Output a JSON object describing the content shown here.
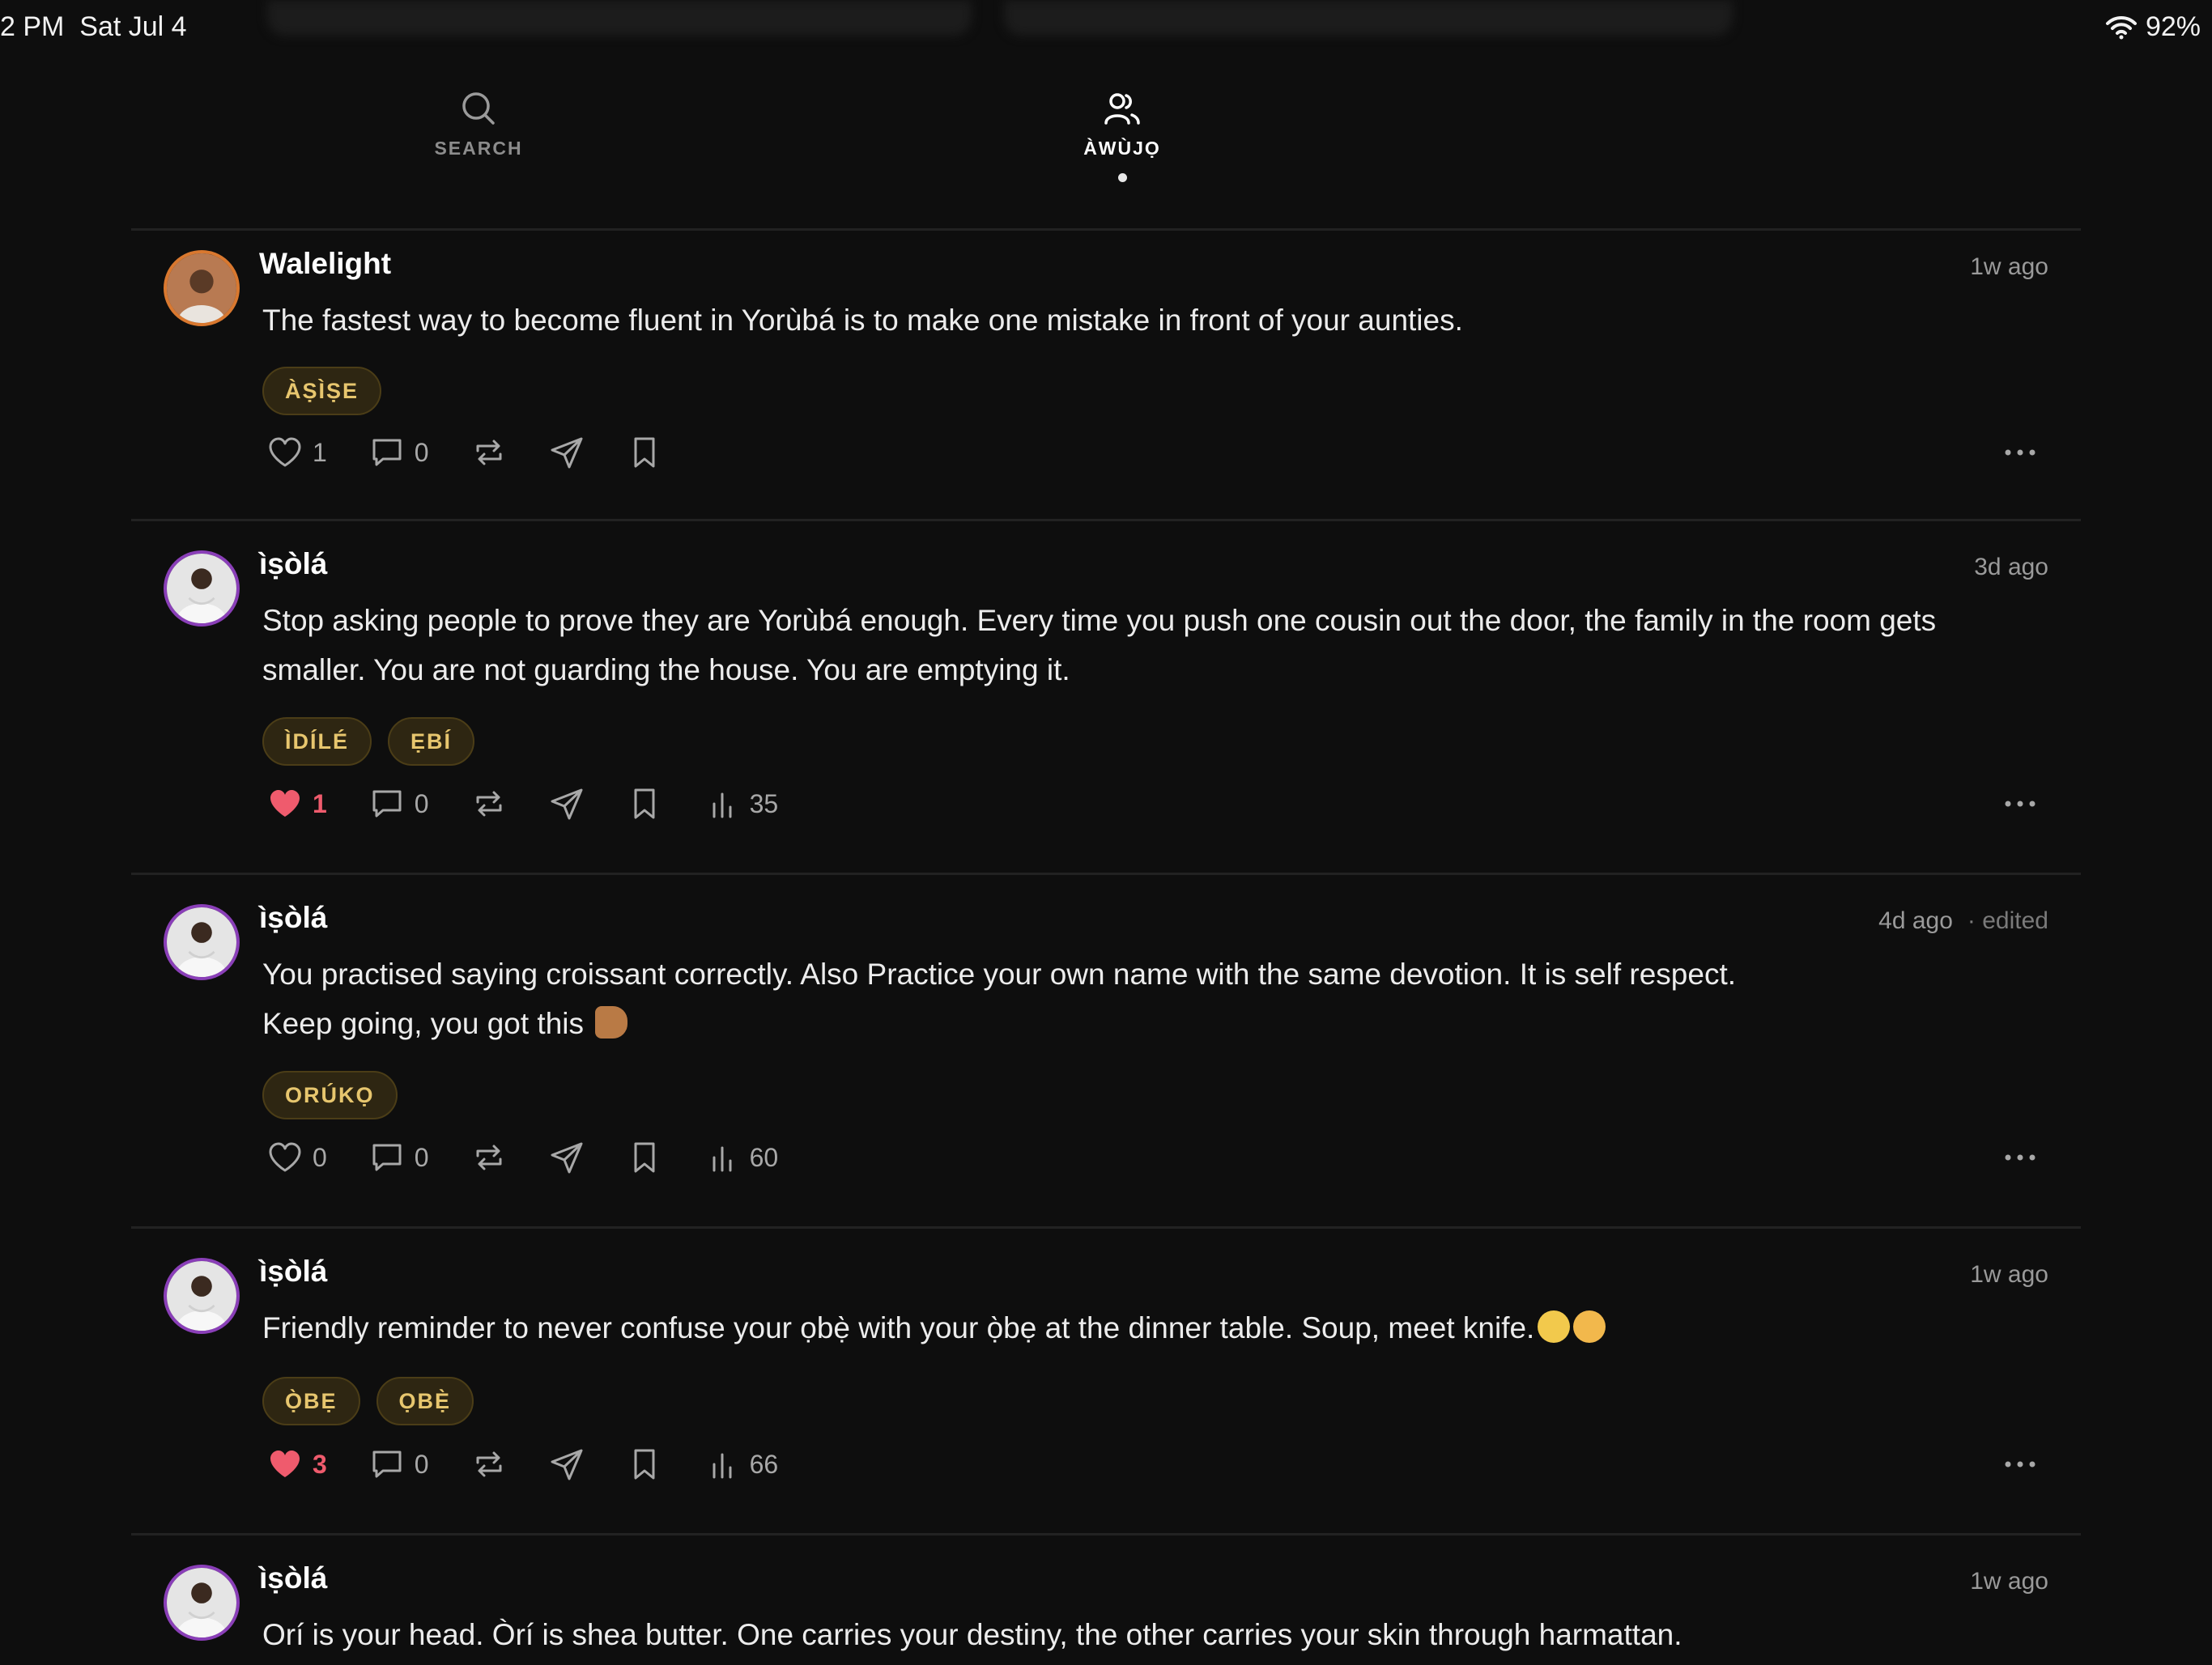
{
  "status_bar": {
    "time": "2 PM",
    "date": "Sat Jul 4",
    "battery": "92%"
  },
  "tabs": [
    {
      "label": "SEARCH",
      "icon": "search-icon",
      "active": false
    },
    {
      "label": "ÀWÙJỌ",
      "icon": "users-icon",
      "active": true
    }
  ],
  "posts": [
    {
      "username": "Walelight",
      "time": "1w ago",
      "content": "The fastest way to become fluent in Yorùbá is to make one mistake in front of your aunties.",
      "tags": [
        "ÀṢÌṢE"
      ],
      "likes": "1",
      "liked": false,
      "comments": "0"
    },
    {
      "username": "ìṣòlá",
      "time": "3d ago",
      "content": "Stop asking people to prove they are Yorùbá enough. Every time you push one cousin out the door, the family in the room gets smaller. You are not guarding the house. You are emptying it.",
      "tags": [
        "ÌDÍLÉ",
        "ẸBÍ"
      ],
      "likes": "1",
      "liked": true,
      "comments": "0",
      "views": "35"
    },
    {
      "username": "ìṣòlá",
      "time": "4d ago",
      "edited": "· edited",
      "content_lines": [
        "You practised saying croissant correctly. Also Practice your own name with the same devotion. It is self respect.",
        "Keep going, you got this"
      ],
      "emoji": "flexed-biceps-emoji",
      "tags": [
        "ORÚKỌ"
      ],
      "likes": "0",
      "liked": false,
      "comments": "0",
      "views": "60"
    },
    {
      "username": "ìṣòlá",
      "time": "1w ago",
      "content": "Friendly reminder to never confuse your ọbẹ̀ with your ọ̀bẹ at the dinner table. Soup, meet knife.",
      "emoji": [
        "grinning-face-emoji",
        "winking-face-emoji"
      ],
      "tags": [
        "Ọ̀BẸ",
        "ỌBẸ̀"
      ],
      "likes": "3",
      "liked": true,
      "comments": "0",
      "views": "66"
    },
    {
      "username": "ìṣòlá",
      "time": "1w ago",
      "content": "Orí is your head. Òrí is shea butter. One carries your destiny, the other carries your skin through harmattan."
    }
  ],
  "colors": {
    "background": "#0e0e0e",
    "tag_bg": "#2e2612",
    "tag_text": "#e7c66e",
    "liked": "#ef5b6d",
    "avatar_ring_walelight": "#d9782f",
    "avatar_ring_isola": "#8a3fb8"
  }
}
